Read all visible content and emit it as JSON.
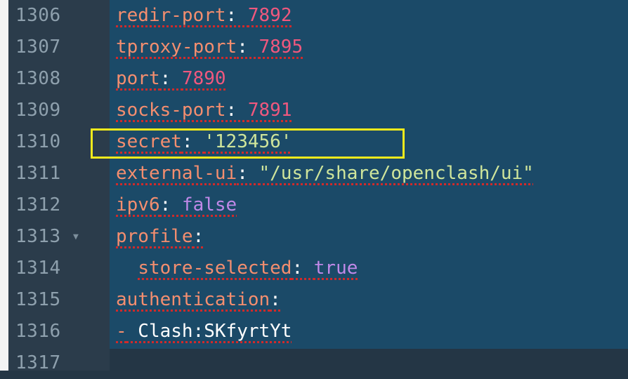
{
  "editor": {
    "colors": {
      "background": "#243645",
      "gutter": "#2b3c4b",
      "selection": "#1b4a68",
      "key": "#f48e6f",
      "number": "#f0587e",
      "string": "#cfe59b",
      "boolean": "#c089e8",
      "highlight_box": "#f2ea1c",
      "spell_underline": "#d12a2a"
    },
    "lines": [
      {
        "number": "1306",
        "key": "redir-port",
        "sep": ": ",
        "value": "7892"
      },
      {
        "number": "1307",
        "key": "tproxy-port",
        "sep": ": ",
        "value": "7895"
      },
      {
        "number": "1308",
        "key": "port",
        "sep": ": ",
        "value": "7890"
      },
      {
        "number": "1309",
        "key": "socks-port",
        "sep": ": ",
        "value": "7891"
      },
      {
        "number": "1310",
        "key": "secret",
        "sep": ": ",
        "value": "'123456'"
      },
      {
        "number": "1311",
        "key": "external-ui",
        "sep": ": ",
        "value": "\"/usr/share/openclash/ui\""
      },
      {
        "number": "1312",
        "key": "ipv6",
        "sep": ": ",
        "value": "false"
      },
      {
        "number": "1313",
        "key": "profile",
        "sep": ":",
        "value": "",
        "fold_icon": "fold-triangle-down"
      },
      {
        "number": "1314",
        "indent": "  ",
        "key": "store-selected",
        "sep": ": ",
        "value": "true"
      },
      {
        "number": "1315",
        "key": "authentication",
        "sep": ":",
        "value": ""
      },
      {
        "number": "1316",
        "dash": "-",
        "value": " Clash:SKfyrtYt"
      },
      {
        "number": "1317"
      }
    ],
    "fold_glyph": "▼"
  }
}
